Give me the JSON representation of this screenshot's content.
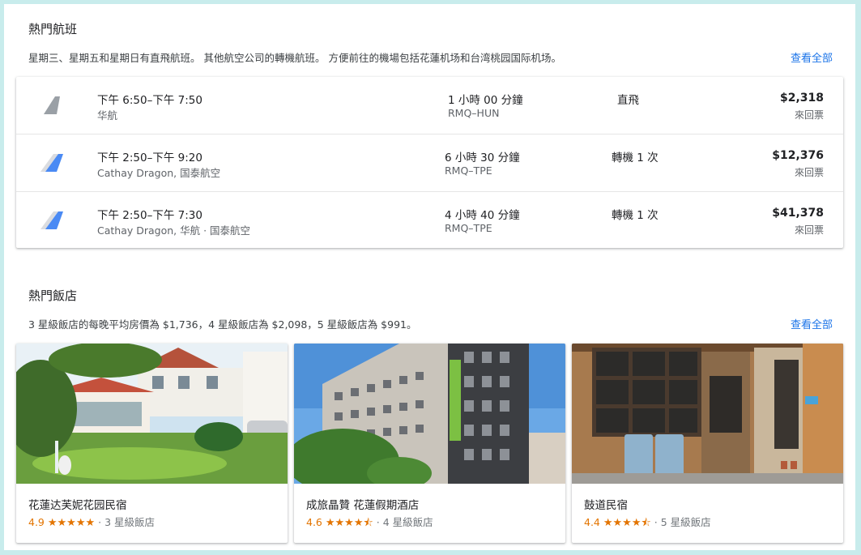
{
  "flights_section": {
    "title": "熱門航班",
    "description": "星期三、星期五和星期日有直飛航班。 其他航空公司的轉機航班。 方便前往的機場包括花蓮机场和台湾桃园国际机场。",
    "view_all": "查看全部",
    "flights": [
      {
        "time": "下午 6:50–下午 7:50",
        "airline": "华航",
        "duration": "1 小時 00 分鐘",
        "route": "RMQ–HUN",
        "stops": "直飛",
        "price": "$2,318",
        "price_type": "來回票",
        "logo": "gray-tail-icon"
      },
      {
        "time": "下午 2:50–下午 9:20",
        "airline": "Cathay Dragon, 国泰航空",
        "duration": "6 小時 30 分鐘",
        "route": "RMQ–TPE",
        "stops": "轉機 1 次",
        "price": "$12,376",
        "price_type": "來回票",
        "logo": "multi-airline-icon"
      },
      {
        "time": "下午 2:50–下午 7:30",
        "airline": "Cathay Dragon, 华航 · 国泰航空",
        "duration": "4 小時 40 分鐘",
        "route": "RMQ–TPE",
        "stops": "轉機 1 次",
        "price": "$41,378",
        "price_type": "來回票",
        "logo": "multi-airline-icon"
      }
    ]
  },
  "hotels_section": {
    "title": "熱門飯店",
    "description": "3 星級飯店的每晚平均房價為 $1,736，4 星級飯店為 $2,098，5 星級飯店為 $991。",
    "view_all": "查看全部",
    "hotels": [
      {
        "name": "花蓮达芙妮花园民宿",
        "score": "4.9",
        "stars": "★★★★★",
        "class": "· 3 星級飯店"
      },
      {
        "name": "成旅晶贊 花蓮假期酒店",
        "score": "4.6",
        "stars": "★★★★⯪",
        "class": "· 4 星級飯店"
      },
      {
        "name": "鼓道民宿",
        "score": "4.4",
        "stars": "★★★★⯪",
        "class": "· 5 星級飯店"
      }
    ]
  },
  "colors": {
    "accent": "#1a73e8",
    "star": "#e37400",
    "frame": "#c8ecec"
  }
}
